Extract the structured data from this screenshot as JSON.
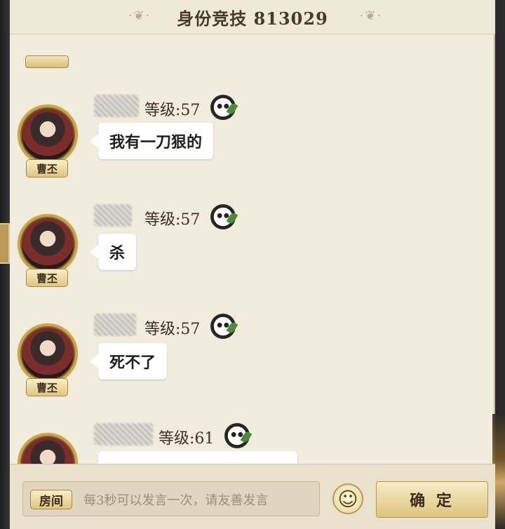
{
  "header": {
    "title": "身份竞技 813029"
  },
  "messages": [
    {
      "name_badge": "曹丕",
      "level": "等级:57",
      "text": "我有一刀狠的"
    },
    {
      "name_badge": "曹丕",
      "level": "等级:57",
      "text": "杀"
    },
    {
      "name_badge": "曹丕",
      "level": "等级:57",
      "text": "死不了"
    },
    {
      "name_badge": "",
      "level": "等级:61",
      "text": ""
    }
  ],
  "bottom": {
    "room_label": "房间",
    "input_placeholder": "每3秒可以发言一次，请友善发言",
    "emoji_icon": "smiley-icon",
    "confirm_label": "确 定"
  },
  "colors": {
    "panel_bg": "#f1ecdd",
    "gold_accent": "#c8a24e",
    "bubble_bg": "#ffffff"
  }
}
